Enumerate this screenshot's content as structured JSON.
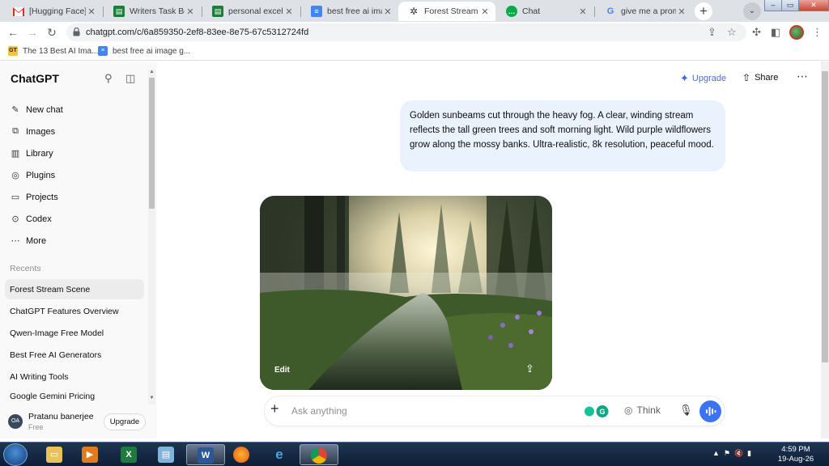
{
  "browser": {
    "tabs": [
      {
        "label": "[Hugging Face] Ch",
        "favicon": "gmail-icon",
        "active": false
      },
      {
        "label": "Writers Task Box",
        "favicon": "sheets-icon",
        "active": false
      },
      {
        "label": "personal excel of",
        "favicon": "sheets-icon",
        "active": false
      },
      {
        "label": "best free ai image",
        "favicon": "docs-icon",
        "active": false
      },
      {
        "label": "Forest Stream Sce",
        "favicon": "chatgpt-icon",
        "active": true
      },
      {
        "label": "Chat",
        "favicon": "chat-icon",
        "active": false
      },
      {
        "label": "give me a prompt",
        "favicon": "google-icon",
        "active": false
      }
    ],
    "url": "chatgpt.com/c/6a859350-2ef8-83ee-8e75-67c5312724fd",
    "bookmarks": [
      {
        "label": "The 13 Best AI Ima...",
        "favicon": "gt-icon"
      },
      {
        "label": "best free ai image g...",
        "favicon": "docs-icon"
      }
    ]
  },
  "sidebar": {
    "brand": "ChatGPT",
    "nav": [
      {
        "label": "New chat",
        "icon": "edit-icon"
      },
      {
        "label": "Images",
        "icon": "images-icon"
      },
      {
        "label": "Library",
        "icon": "library-icon"
      },
      {
        "label": "Plugins",
        "icon": "plugins-icon"
      },
      {
        "label": "Projects",
        "icon": "folder-icon"
      },
      {
        "label": "Codex",
        "icon": "codex-icon"
      },
      {
        "label": "More",
        "icon": "more-icon"
      }
    ],
    "recents_heading": "Recents",
    "recents": [
      "Forest Stream Scene",
      "ChatGPT Features Overview",
      "Qwen-Image Free Model",
      "Best Free AI Generators",
      "AI Writing Tools",
      "Google Gemini Pricing"
    ],
    "user": {
      "initials": "OA",
      "name": "Pratanu banerjee",
      "plan": "Free",
      "upgrade": "Upgrade"
    }
  },
  "header": {
    "upgrade": "Upgrade",
    "share": "Share"
  },
  "conversation": {
    "user_message": " Golden sunbeams cut through the heavy fog. A clear, winding stream reflects the tall green trees and soft morning light. Wild purple wildflowers grow along the mossy banks. Ultra-realistic, 8k resolution, peaceful mood.",
    "image_edit_label": "Edit"
  },
  "composer": {
    "placeholder": "Ask anything",
    "think_label": "Think"
  },
  "taskbar": {
    "time": "4:59 PM",
    "date": "19-Aug-26"
  },
  "colors": {
    "accent": "#3a74f5",
    "bubble": "#e9f2fd",
    "upgrade_text": "#4d6bdb"
  }
}
